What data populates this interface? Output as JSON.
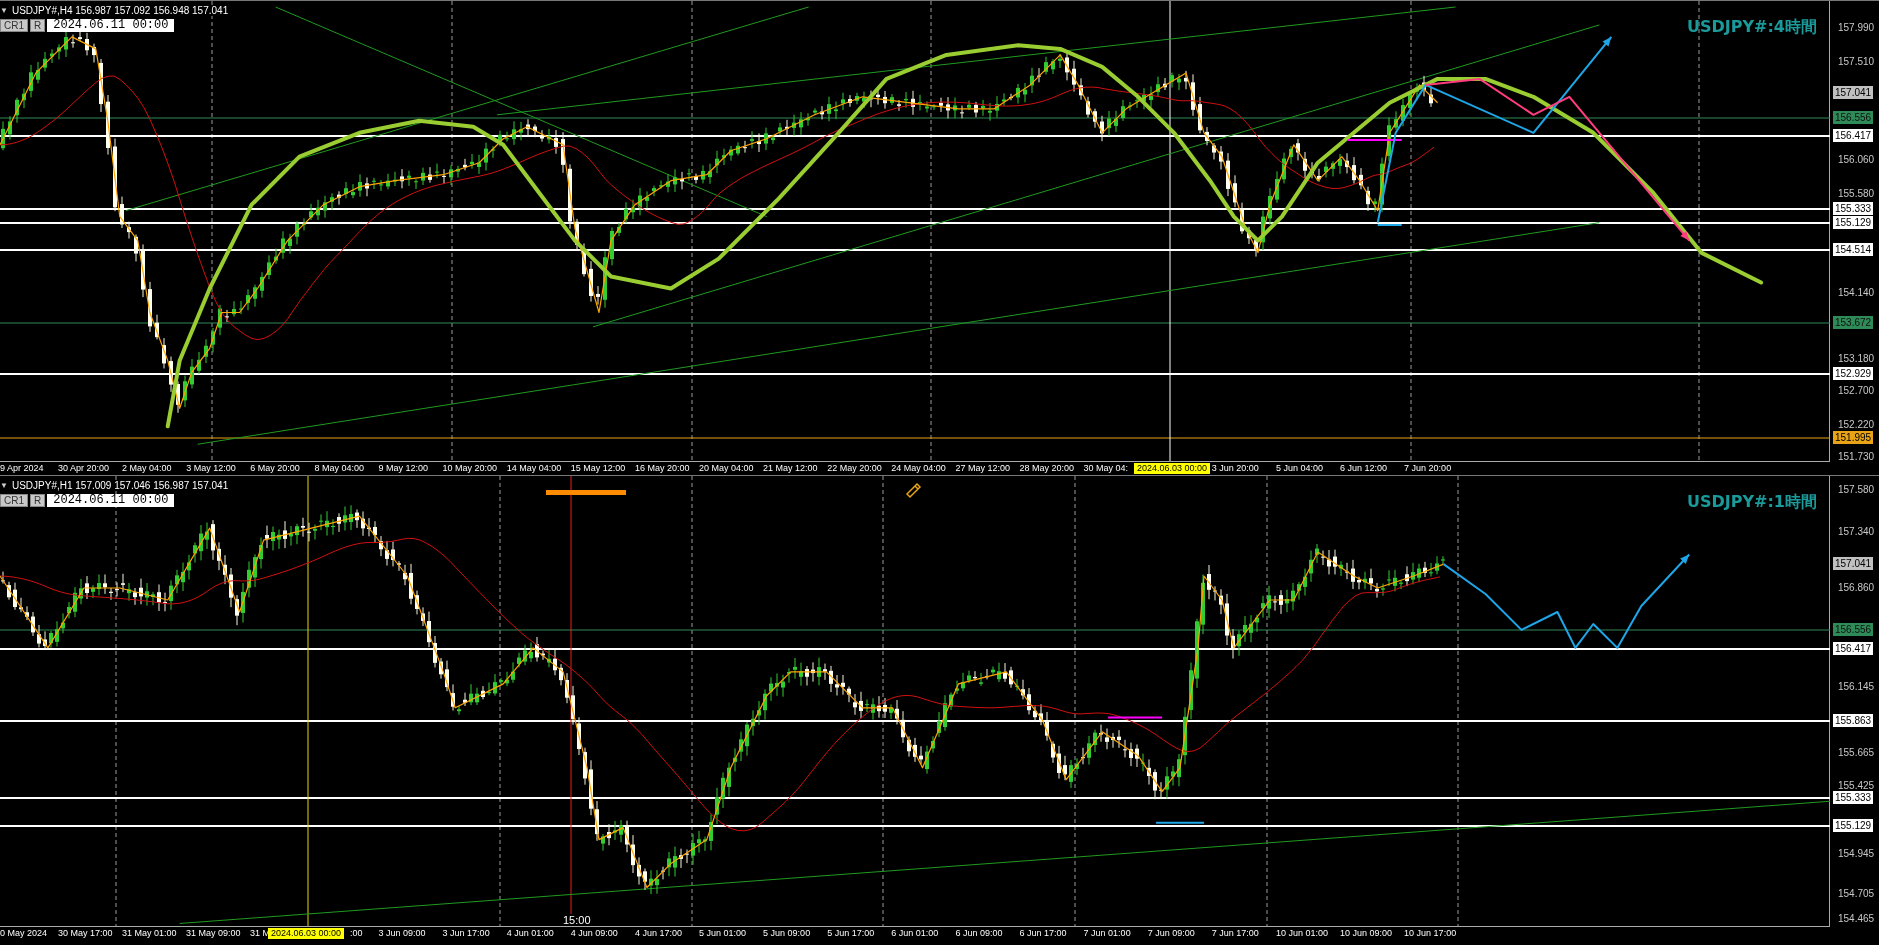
{
  "charts": [
    {
      "header": {
        "menu_glyph": "▼",
        "symbol_info": "USDJPY#,H4  156.987 157.092 156.948 157.041",
        "buttons": [
          "CR1",
          "R"
        ],
        "date_field": "2024.06.11 00:00"
      },
      "title": "USDJPY#:4時間",
      "price_labels": [
        {
          "text": "157.990",
          "kind": "tick"
        },
        {
          "text": "157.510",
          "kind": "tick"
        },
        {
          "text": "157.041",
          "kind": "price",
          "color": "#c0c0c0"
        },
        {
          "text": "156.556",
          "kind": "level",
          "color": "#2e8b57"
        },
        {
          "text": "156.417",
          "kind": "level",
          "color": "#ffffff"
        },
        {
          "text": "156.060",
          "kind": "tick"
        },
        {
          "text": "155.580",
          "kind": "tick"
        },
        {
          "text": "155.333",
          "kind": "level",
          "color": "#ffffff"
        },
        {
          "text": "155.129",
          "kind": "level",
          "color": "#ffffff"
        },
        {
          "text": "154.514",
          "kind": "level",
          "color": "#ffffff"
        },
        {
          "text": "154.140",
          "kind": "tick"
        },
        {
          "text": "153.672",
          "kind": "level",
          "color": "#2e8b57"
        },
        {
          "text": "153.180",
          "kind": "tick"
        },
        {
          "text": "152.929",
          "kind": "level",
          "color": "#ffffff"
        },
        {
          "text": "152.700",
          "kind": "tick"
        },
        {
          "text": "152.220",
          "kind": "tick"
        },
        {
          "text": "151.995",
          "kind": "level",
          "color": "#e8a317"
        },
        {
          "text": "151.730",
          "kind": "tick"
        }
      ],
      "time_labels": [
        {
          "text": "9 Apr 2024",
          "kind": "tick"
        },
        {
          "text": "30 Apr 20:00",
          "kind": "tick"
        },
        {
          "text": "2 May 04:00",
          "kind": "tick"
        },
        {
          "text": "3 May 12:00",
          "kind": "tick"
        },
        {
          "text": "6 May 20:00",
          "kind": "tick"
        },
        {
          "text": "8 May 04:00",
          "kind": "tick"
        },
        {
          "text": "9 May 12:00",
          "kind": "tick"
        },
        {
          "text": "10 May 20:00",
          "kind": "tick"
        },
        {
          "text": "14 May 04:00",
          "kind": "tick"
        },
        {
          "text": "15 May 12:00",
          "kind": "tick"
        },
        {
          "text": "16 May 20:00",
          "kind": "tick"
        },
        {
          "text": "20 May 04:00",
          "kind": "tick"
        },
        {
          "text": "21 May 12:00",
          "kind": "tick"
        },
        {
          "text": "22 May 20:00",
          "kind": "tick"
        },
        {
          "text": "24 May 04:00",
          "kind": "tick"
        },
        {
          "text": "27 May 12:00",
          "kind": "tick"
        },
        {
          "text": "28 May 20:00",
          "kind": "tick"
        },
        {
          "text": "30 May 04:",
          "kind": "tick"
        },
        {
          "text": "2024.06.03 00:00",
          "kind": "cursor"
        },
        {
          "text": "3 Jun 20:00",
          "kind": "tick"
        },
        {
          "text": "5 Jun 04:00",
          "kind": "tick"
        },
        {
          "text": "6 Jun 12:00",
          "kind": "tick"
        },
        {
          "text": "7 Jun 20:00",
          "kind": "tick"
        }
      ]
    },
    {
      "header": {
        "menu_glyph": "▼",
        "symbol_info": "USDJPY#,H1  157.009 157.046 156.987 157.041",
        "buttons": [
          "CR1",
          "R"
        ],
        "date_field": "2024.06.11 00:00"
      },
      "title": "USDJPY#:1時間",
      "cursor_time": "15:00",
      "price_labels": [
        {
          "text": "157.580",
          "kind": "tick"
        },
        {
          "text": "157.340",
          "kind": "tick"
        },
        {
          "text": "157.041",
          "kind": "price",
          "color": "#c0c0c0"
        },
        {
          "text": "156.860",
          "kind": "tick"
        },
        {
          "text": "156.556",
          "kind": "level",
          "color": "#2e8b57"
        },
        {
          "text": "156.417",
          "kind": "level",
          "color": "#ffffff"
        },
        {
          "text": "156.145",
          "kind": "tick"
        },
        {
          "text": "155.863",
          "kind": "level",
          "color": "#ffffff"
        },
        {
          "text": "155.665",
          "kind": "tick"
        },
        {
          "text": "155.425",
          "kind": "tick"
        },
        {
          "text": "155.333",
          "kind": "level",
          "color": "#ffffff"
        },
        {
          "text": "155.129",
          "kind": "level",
          "color": "#ffffff"
        },
        {
          "text": "154.945",
          "kind": "tick"
        },
        {
          "text": "154.705",
          "kind": "tick"
        },
        {
          "text": "154.465",
          "kind": "tick"
        }
      ],
      "time_labels": [
        {
          "text": "0 May 2024",
          "kind": "tick"
        },
        {
          "text": "30 May 17:00",
          "kind": "tick"
        },
        {
          "text": "31 May 01:00",
          "kind": "tick"
        },
        {
          "text": "31 May 09:00",
          "kind": "tick"
        },
        {
          "text": "31 M",
          "kind": "tick"
        },
        {
          "text": "2024.06.03 00:00",
          "kind": "cursor"
        },
        {
          "text": ":00",
          "kind": "tick"
        },
        {
          "text": "3 Jun 09:00",
          "kind": "tick"
        },
        {
          "text": "3 Jun 17:00",
          "kind": "tick"
        },
        {
          "text": "4 Jun 01:00",
          "kind": "tick"
        },
        {
          "text": "4 Jun 09:00",
          "kind": "tick"
        },
        {
          "text": "4 Jun 17:00",
          "kind": "tick"
        },
        {
          "text": "5 Jun 01:00",
          "kind": "tick"
        },
        {
          "text": "5 Jun 09:00",
          "kind": "tick"
        },
        {
          "text": "5 Jun 17:00",
          "kind": "tick"
        },
        {
          "text": "6 Jun 01:00",
          "kind": "tick"
        },
        {
          "text": "6 Jun 09:00",
          "kind": "tick"
        },
        {
          "text": "6 Jun 17:00",
          "kind": "tick"
        },
        {
          "text": "7 Jun 01:00",
          "kind": "tick"
        },
        {
          "text": "7 Jun 09:00",
          "kind": "tick"
        },
        {
          "text": "7 Jun 17:00",
          "kind": "tick"
        },
        {
          "text": "10 Jun 01:00",
          "kind": "tick"
        },
        {
          "text": "10 Jun 09:00",
          "kind": "tick"
        },
        {
          "text": "10 Jun 17:00",
          "kind": "tick"
        }
      ]
    }
  ]
}
